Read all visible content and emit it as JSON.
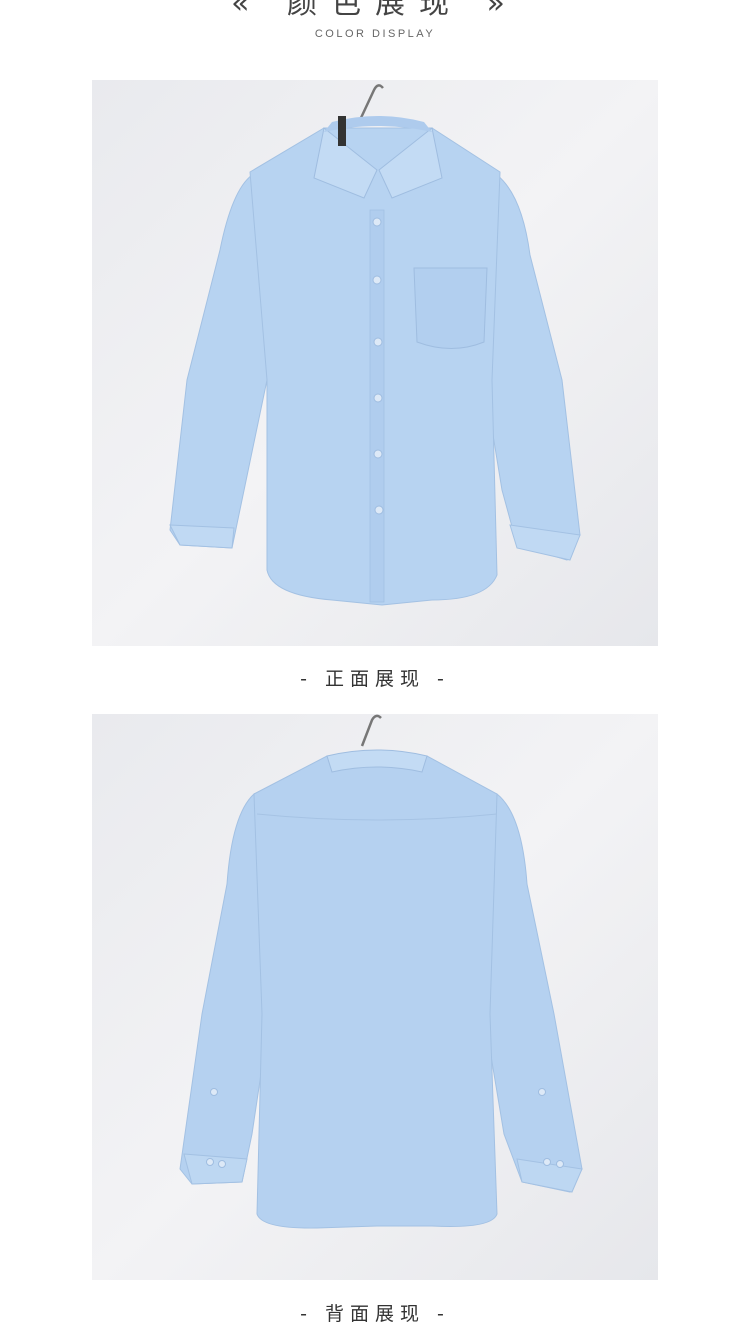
{
  "header": {
    "title_zh": "« 颜色展现 »",
    "title_en": "COLOR DISPLAY"
  },
  "photos": [
    {
      "view": "front",
      "caption": "- 正面展现 -",
      "garment_color": "#b7d3f1"
    },
    {
      "view": "back",
      "caption": "- 背面展现 -",
      "garment_color": "#b5d1f0"
    }
  ]
}
